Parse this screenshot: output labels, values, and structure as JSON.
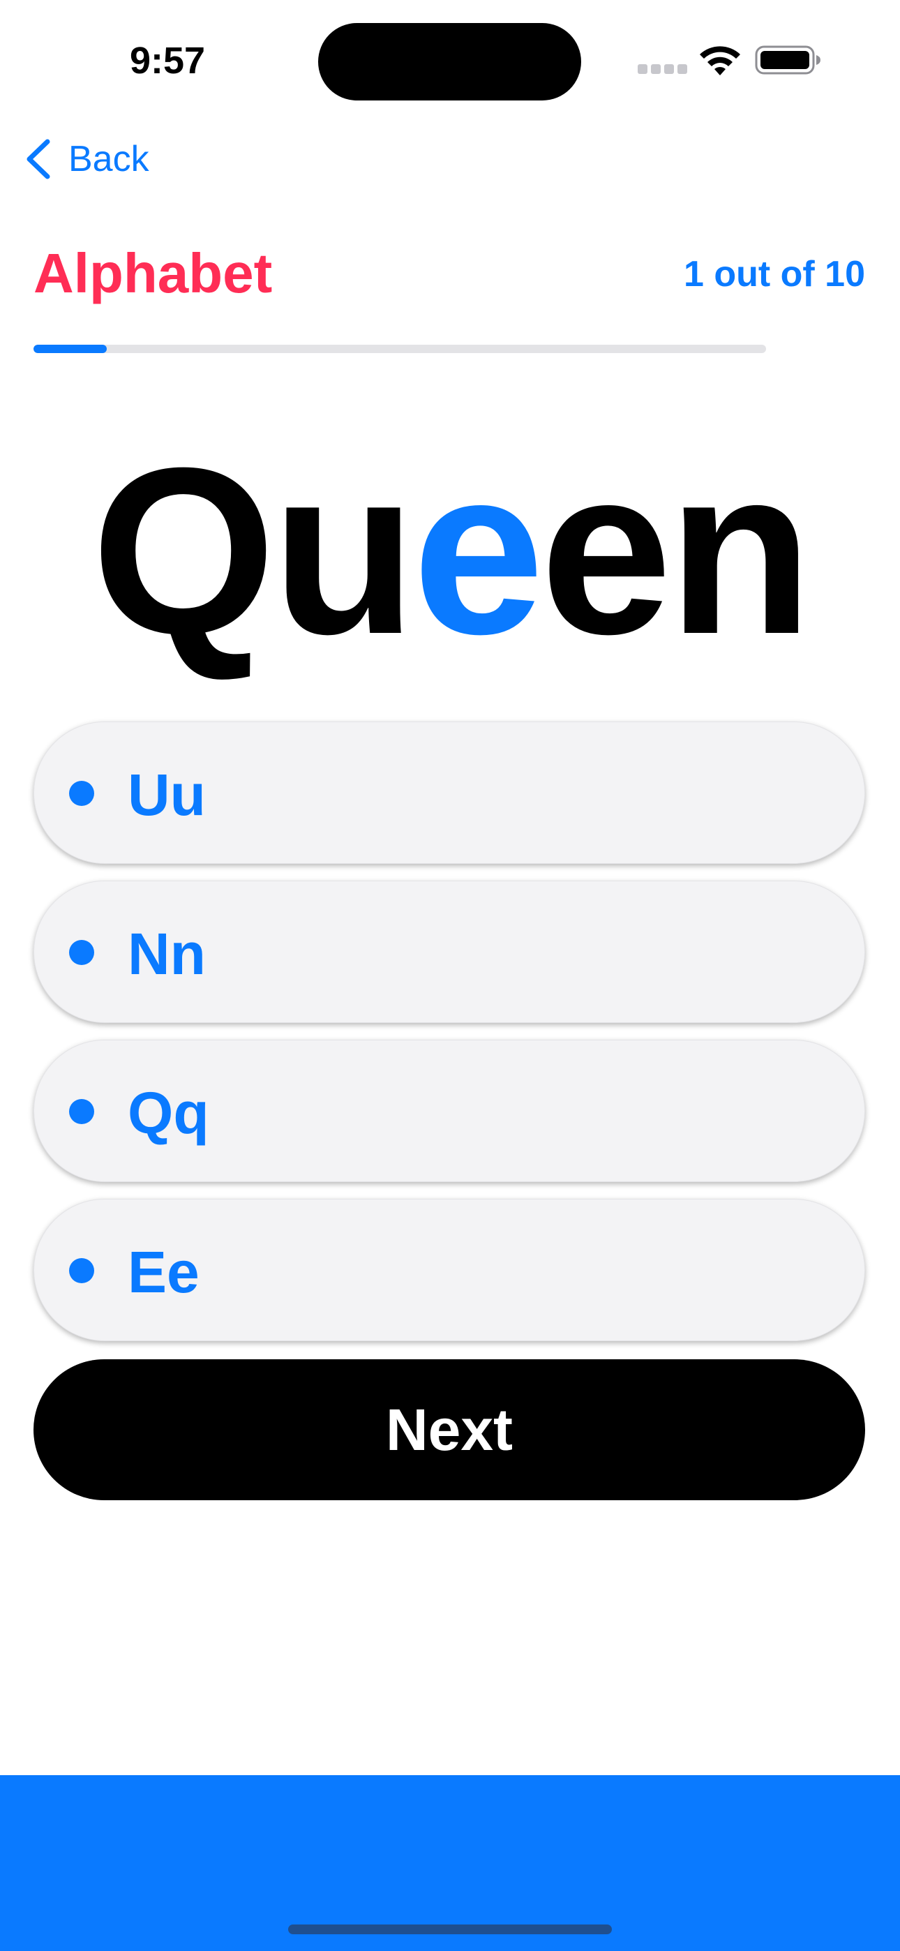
{
  "status_bar": {
    "time": "9:57",
    "icons": [
      "cellular-signal-icon",
      "wifi-icon",
      "battery-icon"
    ]
  },
  "navigation": {
    "back_label": "Back",
    "back_icon": "chevron-left-icon"
  },
  "header": {
    "title": "Alphabet",
    "progress_text": "1 out of 10",
    "progress_fraction": 0.1
  },
  "word": {
    "before": "Qu",
    "highlight": "e",
    "after": "en"
  },
  "options": [
    {
      "label": "Uu"
    },
    {
      "label": "Nn"
    },
    {
      "label": "Qq"
    },
    {
      "label": "Ee"
    }
  ],
  "next_button": {
    "label": "Next"
  },
  "colors": {
    "accent": "#0a7aff",
    "title": "#ff2d55",
    "button": "#000000",
    "option_background": "#f3f3f5",
    "progress_track": "#e3e3e6"
  }
}
